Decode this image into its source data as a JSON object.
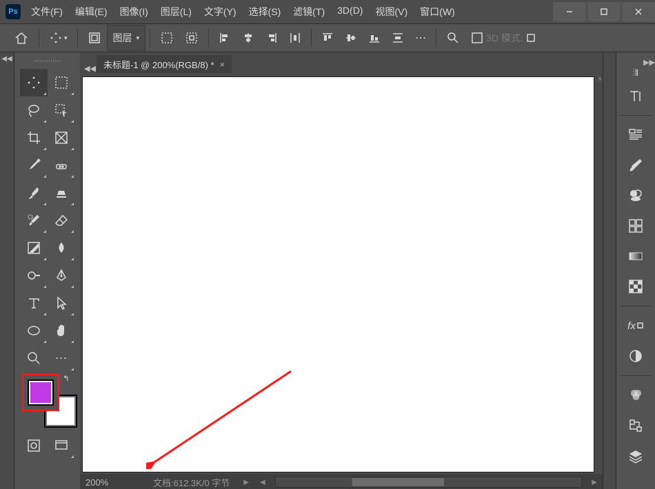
{
  "app": {
    "logo_text": "Ps"
  },
  "menu": {
    "file": "文件(F)",
    "edit": "编辑(E)",
    "image": "图像(I)",
    "layer": "图层(L)",
    "type": "文字(Y)",
    "select": "选择(S)",
    "filter": "滤镜(T)",
    "threeD": "3D(D)",
    "view": "视图(V)",
    "window": "窗口(W)"
  },
  "window_controls": {
    "minimize": "–",
    "maximize": "▢",
    "close": "✕"
  },
  "options_bar": {
    "layer_dropdown": "图层",
    "mode_3d": "3D 模式:"
  },
  "document": {
    "tab_title": "未标题-1 @ 200%(RGB/8) *",
    "zoom": "200%",
    "doc_size": "文档:612.3K/0 字节"
  },
  "tools": {
    "move": "move",
    "marquee": "marquee",
    "lasso": "lasso",
    "quicksel": "quick-select",
    "crop": "crop",
    "frame": "frame",
    "eyedropper": "eyedropper",
    "healing": "healing",
    "brush": "brush",
    "stamp": "clone-stamp",
    "history": "history-brush",
    "eraser": "eraser",
    "gradient": "gradient",
    "blur": "blur",
    "dodge": "dodge",
    "pen": "pen",
    "type": "type",
    "path": "path-select",
    "shape": "shape",
    "hand": "hand",
    "zoom": "zoom",
    "more": "edit-toolbar",
    "quickmask": "quick-mask",
    "screenmode": "screen-mode"
  },
  "right_panel": {
    "character": "character",
    "paragraph": "paragraph",
    "brushes": "brushes",
    "swatches": "swatches",
    "libraries": "libraries",
    "gradients": "gradients",
    "patterns": "patterns",
    "fx": "layer-fx",
    "adjustments": "adjustments",
    "channels": "channels",
    "paths": "paths",
    "layers": "layers"
  },
  "colors": {
    "foreground": "#c139e6",
    "background": "#ffffff",
    "highlight_box": "#ff1a1a"
  }
}
